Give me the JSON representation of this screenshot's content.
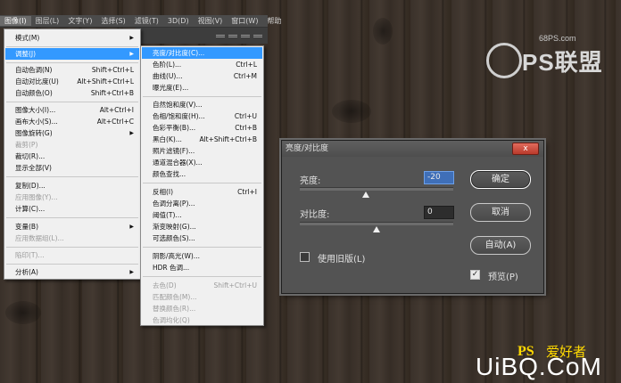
{
  "menubar": {
    "items": [
      "图像(I)",
      "图层(L)",
      "文字(Y)",
      "选择(S)",
      "滤镜(T)",
      "3D(D)",
      "视图(V)",
      "窗口(W)",
      "帮助"
    ]
  },
  "image_menu": {
    "items": [
      {
        "label": "模式(M)",
        "shortcut": "",
        "submenu": true,
        "disabled": false
      },
      {
        "label": "调整(J)",
        "shortcut": "",
        "submenu": true,
        "disabled": false,
        "highlighted": true
      },
      {
        "label": "自动色调(N)",
        "shortcut": "Shift+Ctrl+L",
        "disabled": false
      },
      {
        "label": "自动对比度(U)",
        "shortcut": "Alt+Shift+Ctrl+L",
        "disabled": false
      },
      {
        "label": "自动颜色(O)",
        "shortcut": "Shift+Ctrl+B",
        "disabled": false
      },
      {
        "label": "图像大小(I)...",
        "shortcut": "Alt+Ctrl+I",
        "disabled": false
      },
      {
        "label": "画布大小(S)...",
        "shortcut": "Alt+Ctrl+C",
        "disabled": false
      },
      {
        "label": "图像旋转(G)",
        "shortcut": "",
        "submenu": true,
        "disabled": false
      },
      {
        "label": "裁剪(P)",
        "shortcut": "",
        "disabled": true
      },
      {
        "label": "裁切(R)...",
        "shortcut": "",
        "disabled": false
      },
      {
        "label": "显示全部(V)",
        "shortcut": "",
        "disabled": false
      },
      {
        "label": "复制(D)...",
        "shortcut": "",
        "disabled": false
      },
      {
        "label": "应用图像(Y)...",
        "shortcut": "",
        "disabled": true
      },
      {
        "label": "计算(C)...",
        "shortcut": "",
        "disabled": false
      },
      {
        "label": "变量(B)",
        "shortcut": "",
        "submenu": true,
        "disabled": false
      },
      {
        "label": "应用数据组(L)...",
        "shortcut": "",
        "disabled": true
      },
      {
        "label": "陷印(T)...",
        "shortcut": "",
        "disabled": true
      },
      {
        "label": "分析(A)",
        "shortcut": "",
        "submenu": true,
        "disabled": false
      }
    ]
  },
  "adjust_menu": {
    "items": [
      {
        "label": "亮度/对比度(C)...",
        "shortcut": "",
        "highlighted": true
      },
      {
        "label": "色阶(L)...",
        "shortcut": "Ctrl+L"
      },
      {
        "label": "曲线(U)...",
        "shortcut": "Ctrl+M"
      },
      {
        "label": "曝光度(E)...",
        "shortcut": ""
      },
      {
        "label": "自然饱和度(V)...",
        "shortcut": ""
      },
      {
        "label": "色相/饱和度(H)...",
        "shortcut": "Ctrl+U"
      },
      {
        "label": "色彩平衡(B)...",
        "shortcut": "Ctrl+B"
      },
      {
        "label": "黑白(K)...",
        "shortcut": "Alt+Shift+Ctrl+B"
      },
      {
        "label": "照片滤镜(F)...",
        "shortcut": ""
      },
      {
        "label": "通道混合器(X)...",
        "shortcut": ""
      },
      {
        "label": "颜色查找...",
        "shortcut": ""
      },
      {
        "label": "反相(I)",
        "shortcut": "Ctrl+I"
      },
      {
        "label": "色调分离(P)...",
        "shortcut": ""
      },
      {
        "label": "阈值(T)...",
        "shortcut": ""
      },
      {
        "label": "渐变映射(G)...",
        "shortcut": ""
      },
      {
        "label": "可选颜色(S)...",
        "shortcut": ""
      },
      {
        "label": "阴影/高光(W)...",
        "shortcut": ""
      },
      {
        "label": "HDR 色调...",
        "shortcut": ""
      },
      {
        "label": "去色(D)",
        "shortcut": "Shift+Ctrl+U",
        "disabled": true
      },
      {
        "label": "匹配颜色(M)...",
        "shortcut": "",
        "disabled": true
      },
      {
        "label": "替换颜色(R)...",
        "shortcut": "",
        "disabled": true
      },
      {
        "label": "色调均化(Q)",
        "shortcut": "",
        "disabled": true
      }
    ]
  },
  "logo": {
    "site": "68PS.com",
    "name": "PS联盟"
  },
  "dialog": {
    "title": "亮度/对比度",
    "close": "x",
    "brightness_label": "亮度:",
    "brightness_value": "-20",
    "contrast_label": "对比度:",
    "contrast_value": "0",
    "legacy_label": "使用旧版(L)",
    "legacy_checked": false,
    "ok": "确定",
    "cancel": "取消",
    "auto": "自动(A)",
    "preview_label": "预览(P)",
    "preview_checked": true
  },
  "watermark": {
    "ps": "PS",
    "text": "爱好者",
    "site": "UiBQ.CoM"
  },
  "colors": {
    "highlight": "#3399ff",
    "dialog_bg": "#535353",
    "close": "#c84a3a",
    "watermark_yellow": "#ffd900"
  }
}
